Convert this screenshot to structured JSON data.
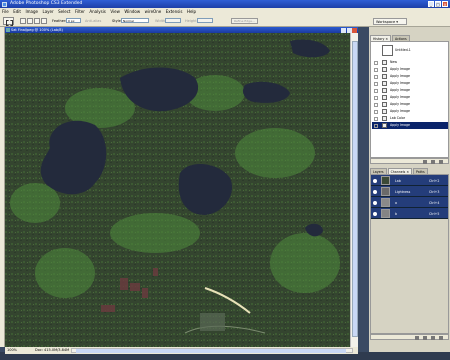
{
  "app": {
    "title": "Adobe Photoshop CS3 Extended",
    "window_buttons": [
      "_",
      "□",
      "×"
    ]
  },
  "menu": [
    "File",
    "Edit",
    "Image",
    "Layer",
    "Select",
    "Filter",
    "Analysis",
    "View",
    "Window",
    "wireOne",
    "Extensis",
    "Help"
  ],
  "options": {
    "feather_label": "Feather:",
    "feather_value": "0 px",
    "antialias_label": "Anti-alias",
    "style_label": "Style:",
    "style_value": "Normal",
    "width_label": "Width:",
    "height_label": "Height:",
    "refine_label": "Refine Edge...",
    "workspace_label": "Workspace ▾"
  },
  "document": {
    "title": "Sat FinalJpeg @ 100% (Lab/8)",
    "zoom": "100%",
    "doc_info": "Doc: 415.0M/3.84M"
  },
  "history": {
    "tabs": [
      "History ×",
      "Actions"
    ],
    "snapshot": "Untitled-1",
    "items": [
      "New",
      "Apply Image",
      "Apply Image",
      "Apply Image",
      "Apply Image",
      "Apply Image",
      "Apply Image",
      "Apply Image",
      "Lab Color",
      "Apply Image"
    ],
    "active_index": 9
  },
  "channels": {
    "tabs": [
      "Layers",
      "Channels ×",
      "Paths"
    ],
    "rows": [
      {
        "name": "Lab",
        "shortcut": "Ctrl+2"
      },
      {
        "name": "Lightness",
        "shortcut": "Ctrl+3"
      },
      {
        "name": "a",
        "shortcut": "Ctrl+4"
      },
      {
        "name": "b",
        "shortcut": "Ctrl+5"
      }
    ]
  }
}
